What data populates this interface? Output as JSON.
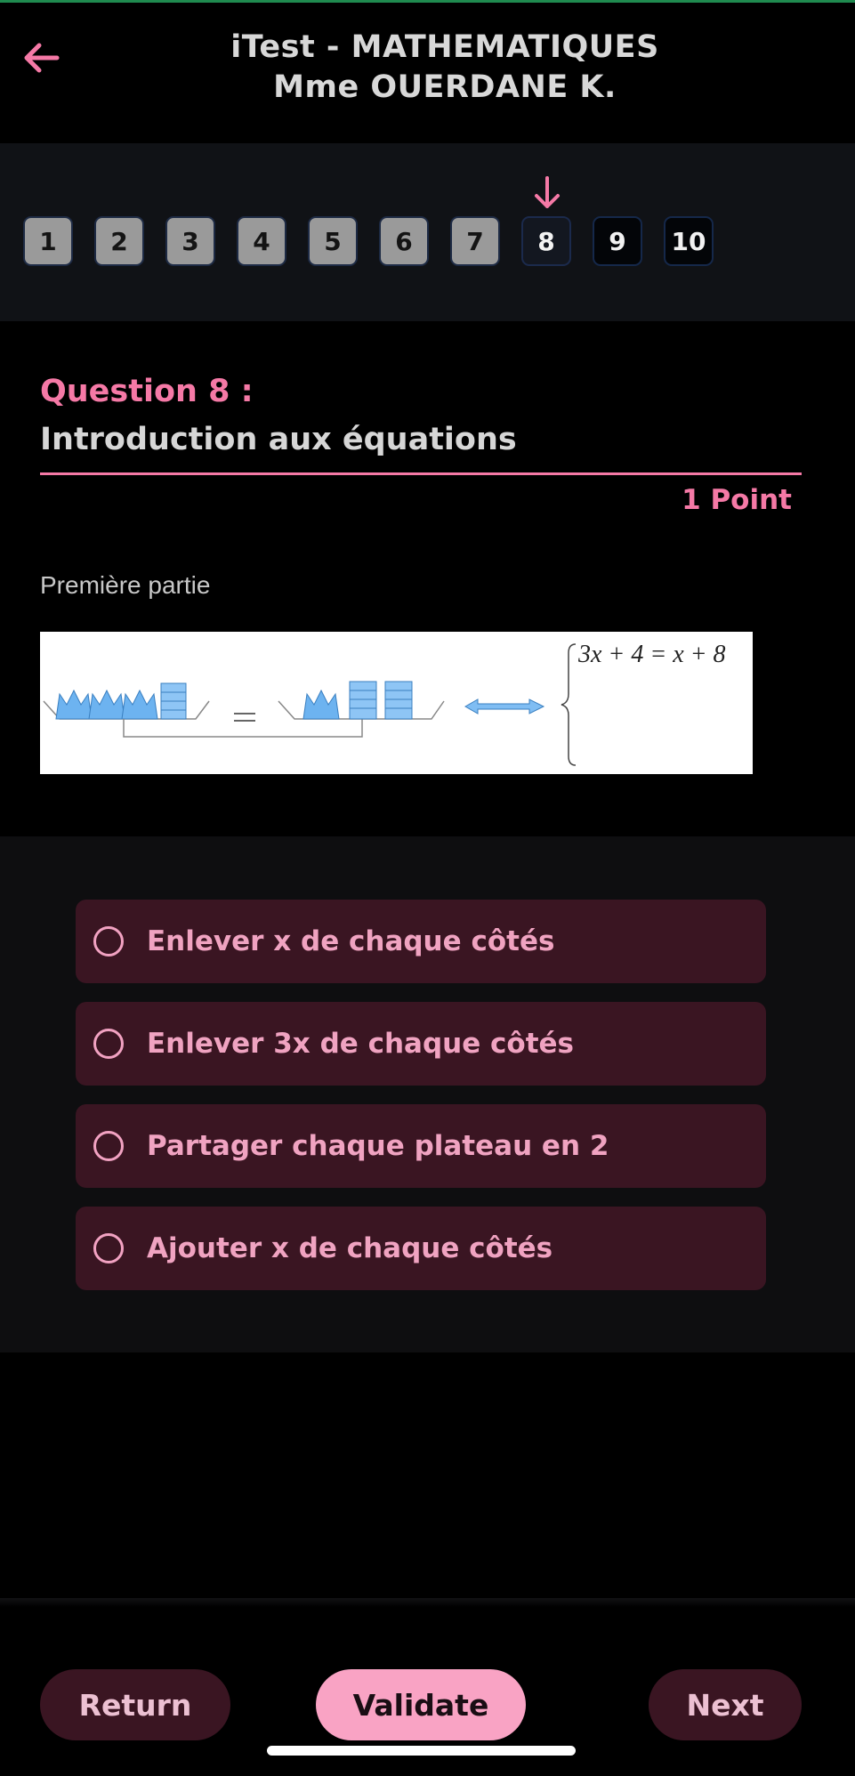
{
  "header": {
    "title_line1": "iTest - MATHEMATIQUES",
    "title_line2": "Mme OUERDANE K.",
    "back_icon": "arrow-left-icon",
    "accent_color": "#f579a6"
  },
  "question_nav": {
    "current": 8,
    "pointer_icon": "arrow-down-icon",
    "items": [
      {
        "label": "1",
        "state": "answered"
      },
      {
        "label": "2",
        "state": "answered"
      },
      {
        "label": "3",
        "state": "answered"
      },
      {
        "label": "4",
        "state": "answered"
      },
      {
        "label": "5",
        "state": "answered"
      },
      {
        "label": "6",
        "state": "answered"
      },
      {
        "label": "7",
        "state": "answered"
      },
      {
        "label": "8",
        "state": "current"
      },
      {
        "label": "9",
        "state": "unanswered"
      },
      {
        "label": "10",
        "state": "unanswered"
      }
    ]
  },
  "question": {
    "label": "Question 8 :",
    "title": "Introduction aux équations",
    "points": "1 Point",
    "part": "Première partie",
    "image": {
      "description_icons": [
        "balance-scale-diagram",
        "double-arrow-icon"
      ],
      "equals_sign": "=",
      "equation": "3x + 4 = x + 8"
    }
  },
  "answers": [
    {
      "label": "Enlever x de chaque côtés",
      "selected": false
    },
    {
      "label": "Enlever 3x de chaque côtés",
      "selected": false
    },
    {
      "label": "Partager chaque plateau en 2",
      "selected": false
    },
    {
      "label": "Ajouter x de chaque côtés",
      "selected": false
    }
  ],
  "footer": {
    "return_label": "Return",
    "validate_label": "Validate",
    "next_label": "Next"
  }
}
